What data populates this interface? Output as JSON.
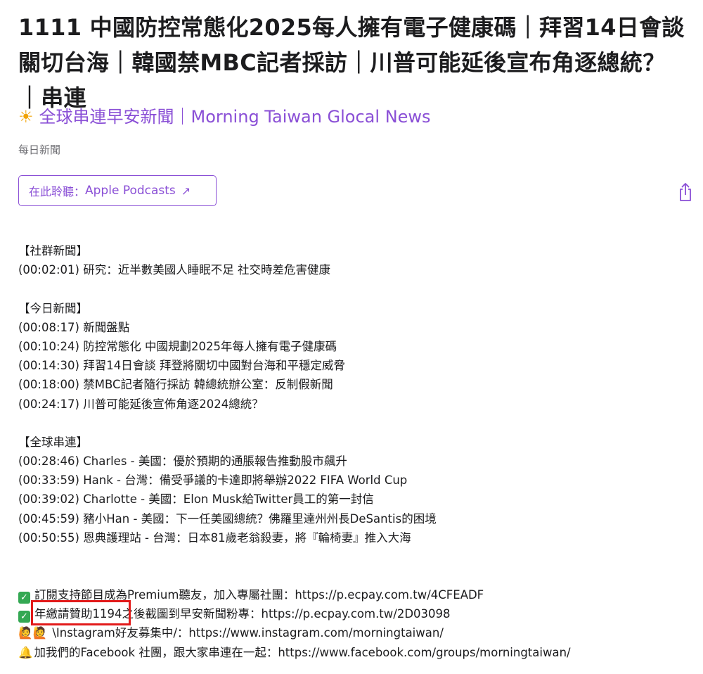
{
  "episode": {
    "title": "1111 中國防控常態化2025每人擁有電子健康碼｜拜習14日會談關切台海｜韓國禁MBC記者採訪｜川普可能延後宣布角逐總統？｜串連",
    "show_name": "全球串連早安新聞｜Morning Taiwan Glocal News",
    "category": "每日新聞",
    "listen_prefix": "在此聆聽：",
    "listen_platform": "Apple Podcasts",
    "arrow_glyph": "↗",
    "sun_glyph": "☀"
  },
  "description": {
    "social_header": "【社群新聞】",
    "social": [
      "(00:02:01) 研究：近半數美國人睡眠不足 社交時差危害健康"
    ],
    "today_header": "【今日新聞】",
    "today": [
      "(00:08:17) 新聞盤點",
      "(00:10:24) 防控常態化 中國規劃2025年每人擁有電子健康碼",
      "(00:14:30) 拜習14日會談 拜登將關切中國對台海和平穩定威脅",
      "(00:18:00) 禁MBC記者隨行採訪 韓總統辦公室：反制假新聞",
      "(00:24:17) 川普可能延後宣佈角逐2024總統？"
    ],
    "global_header": "【全球串連】",
    "global": [
      "(00:28:46) Charles - 美國：優於預期的通脹報告推動股市飆升",
      "(00:33:59) Hank - 台灣：備受爭議的卡達即將舉辦2022 FIFA World Cup",
      "(00:39:02) Charlotte - 美國：Elon Musk給Twitter員工的第一封信",
      "(00:45:59) 豬小Han - 美國：下一任美國總統？佛羅里達州州長DeSantis的困境",
      "(00:50:55) 恩典護理站 - 台灣：日本81歲老翁殺妻，將『輪椅妻』推入大海"
    ],
    "promo": {
      "check_glyph": "✓",
      "line1_text": "訂閱支持節目成為Premium聽友，加入專屬社團：",
      "line1_url": "https://p.ecpay.com.tw/4CFEADF",
      "line2_text": "年繳請贊助1194之後截圖到早安新聞粉專：",
      "line2_url": "https://p.ecpay.com.tw/2D03098",
      "line3_emoji": "🙋🙋",
      "line3_text": " \\Instagram好友募集中/：",
      "line3_url": "https://www.instagram.com/morningtaiwan/",
      "line4_emoji": "🔔",
      "line4_text": "加我們的Facebook 社團，跟大家串連在一起：",
      "line4_url": "https://www.facebook.com/groups/morningtaiwan/"
    }
  },
  "colors": {
    "accent": "#8a4fd6",
    "highlight_box": "#e21a1a",
    "check_green": "#34a853"
  },
  "icons": {
    "share": "share-icon",
    "external": "external-link-arrow-icon",
    "sun": "sun-icon",
    "check": "checkmark-icon"
  }
}
